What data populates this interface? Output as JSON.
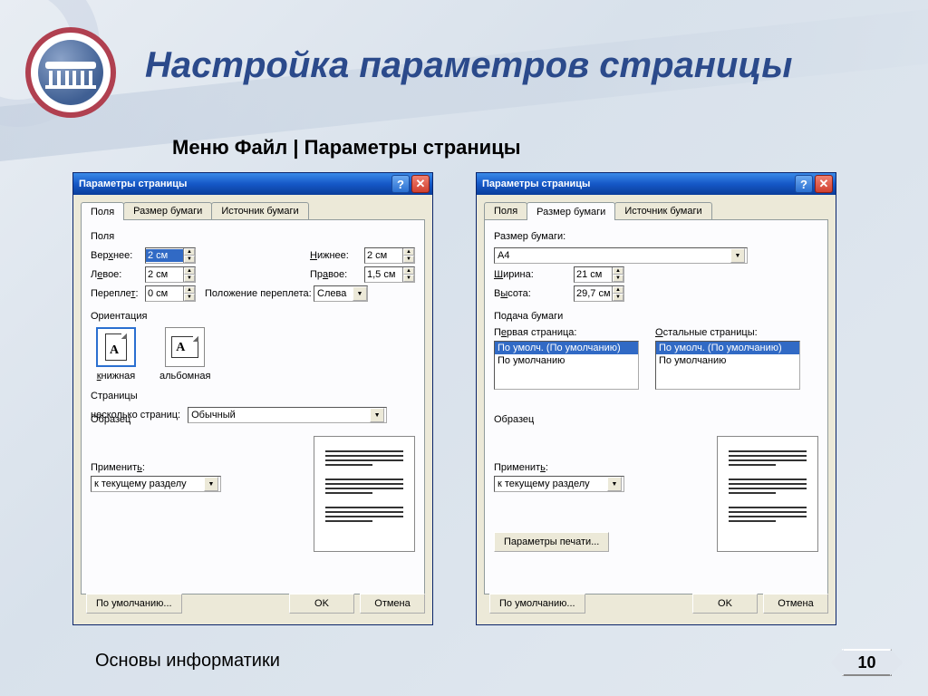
{
  "slide": {
    "title": "Настройка параметров страницы",
    "subtitle": "Меню Файл | Параметры страницы",
    "footer": "Основы информатики",
    "page_number": "10"
  },
  "dialog_common": {
    "title": "Параметры страницы",
    "tabs": {
      "fields": "Поля",
      "paper_size": "Размер бумаги",
      "paper_source": "Источник бумаги"
    },
    "buttons": {
      "default": "По умолчанию...",
      "ok": "OK",
      "cancel": "Отмена"
    },
    "sample_label": "Образец",
    "apply_label": "Применить:",
    "apply_value": "к текущему разделу"
  },
  "left_dialog": {
    "group_fields": "Поля",
    "top_label": "Верхнее:",
    "top_value": "2 см",
    "bottom_label": "Нижнее:",
    "bottom_value": "2 см",
    "left_label": "Левое:",
    "left_value": "2 см",
    "right_label": "Правое:",
    "right_value": "1,5 см",
    "gutter_label": "Переплет:",
    "gutter_value": "0 см",
    "gutter_pos_label": "Положение переплета:",
    "gutter_pos_value": "Слева",
    "group_orientation": "Ориентация",
    "portrait": "книжная",
    "landscape": "альбомная",
    "group_pages": "Страницы",
    "multi_pages_label": "несколько страниц:",
    "multi_pages_value": "Обычный"
  },
  "right_dialog": {
    "group_size": "Размер бумаги:",
    "paper_value": "A4",
    "width_label": "Ширина:",
    "width_value": "21 см",
    "height_label": "Высота:",
    "height_value": "29,7 см",
    "group_feed": "Подача бумаги",
    "first_page": "Первая страница:",
    "other_pages": "Остальные страницы:",
    "list_selected": "По умолч. (По умолчанию)",
    "list_item2": "По умолчанию",
    "print_params": "Параметры печати..."
  }
}
